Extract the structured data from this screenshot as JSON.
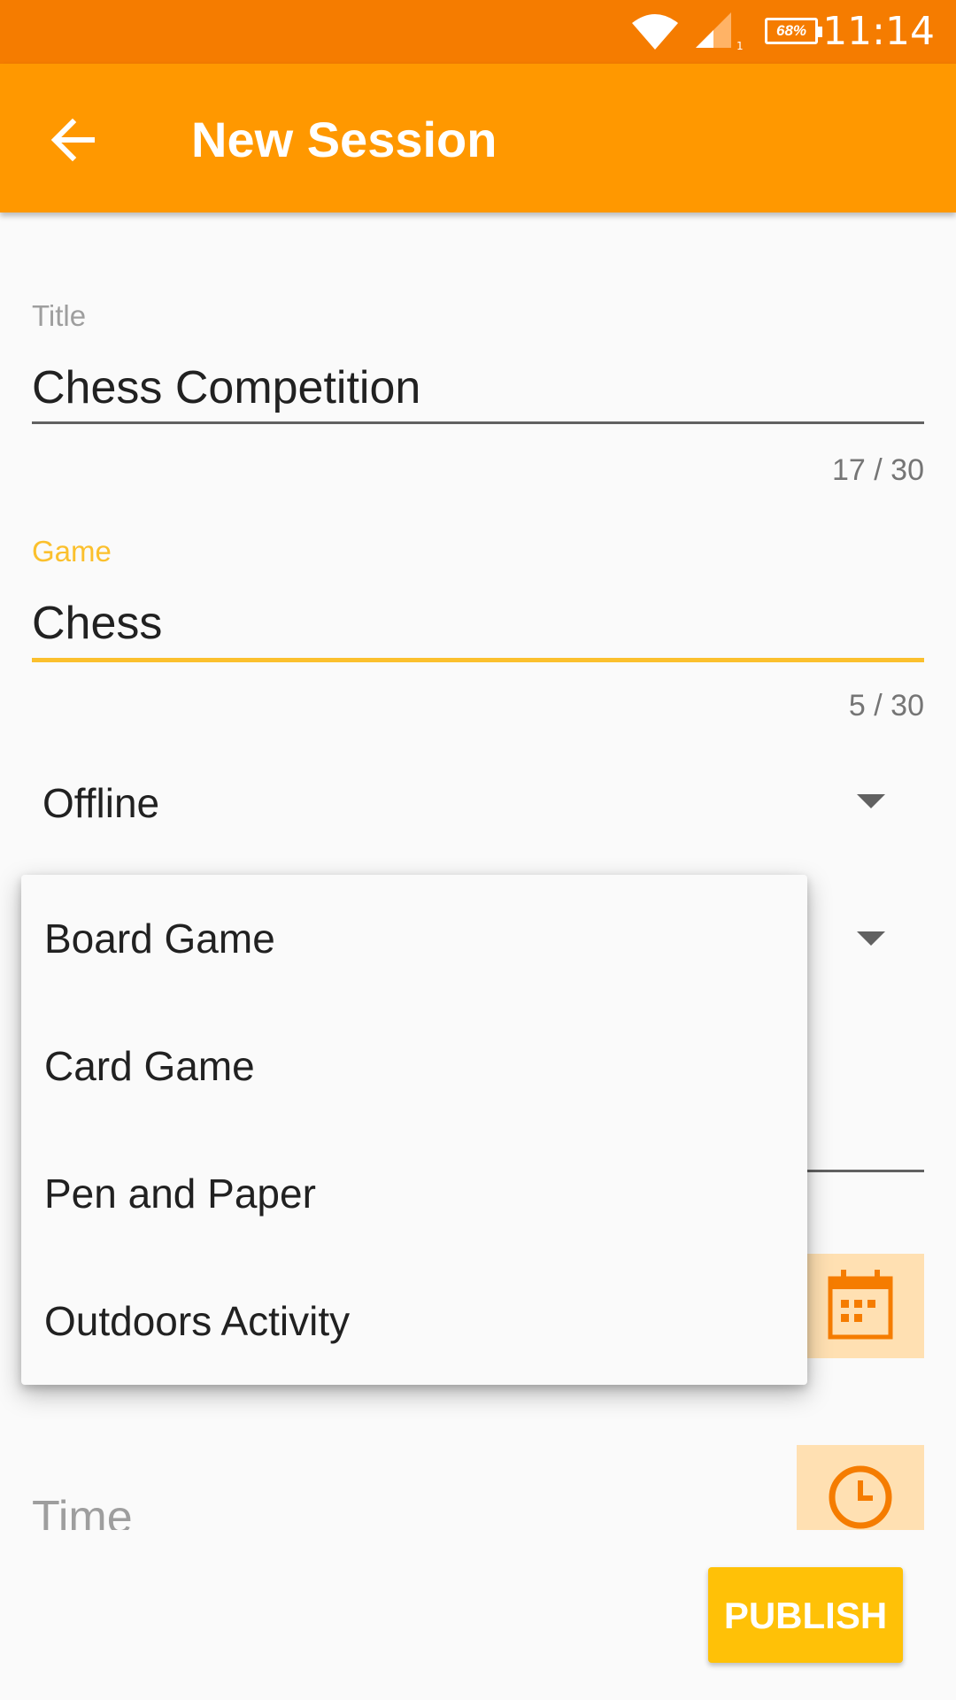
{
  "status_bar": {
    "time": "11:14",
    "battery": "68%",
    "signal_badge": "1",
    "icons": [
      "wifi-icon",
      "cell-signal-icon",
      "battery-icon"
    ]
  },
  "app_bar": {
    "title": "New Session",
    "back_icon": "arrow-back-icon"
  },
  "form": {
    "title_field": {
      "label": "Title",
      "value": "Chess Competition",
      "counter": "17 / 30"
    },
    "game_field": {
      "label": "Game",
      "value": "Chess",
      "counter": "5 / 30"
    },
    "mode_spinner": {
      "value": "Offline"
    },
    "time_field": {
      "placeholder": "Time"
    },
    "date_icon": "calendar-icon",
    "time_icon": "clock-icon",
    "publish_label": "PUBLISH"
  },
  "dropdown": {
    "items": [
      "Board Game",
      "Card Game",
      "Pen and Paper",
      "Outdoors Activity"
    ]
  },
  "colors": {
    "status_bar": "#f57c00",
    "app_bar": "#ff9800",
    "accent": "#fbc02d",
    "publish": "#ffc107",
    "icon_box": "#ffe0b2",
    "icon": "#f57c00"
  }
}
